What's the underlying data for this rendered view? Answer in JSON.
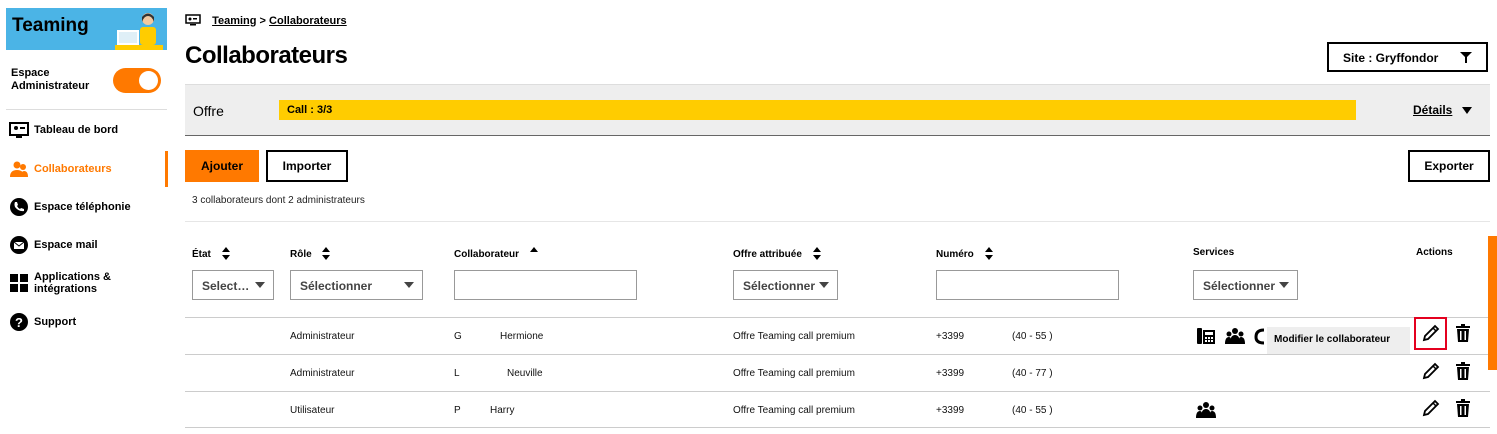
{
  "sidebar": {
    "brand": "Teaming",
    "admin_label": "Espace Administrateur",
    "admin_toggle_on": true,
    "items": [
      {
        "label": "Tableau de bord",
        "icon": "dashboard-icon"
      },
      {
        "label": "Collaborateurs",
        "icon": "users-icon",
        "active": true
      },
      {
        "label": "Espace téléphonie",
        "icon": "phone-icon"
      },
      {
        "label": "Espace mail",
        "icon": "mail-icon"
      },
      {
        "label": "Applications & intégrations",
        "icon": "apps-grid-icon"
      },
      {
        "label": "Support",
        "icon": "help-icon"
      }
    ]
  },
  "breadcrumb": {
    "home": "Teaming",
    "sep": ">",
    "current": "Collaborateurs"
  },
  "page_title": "Collaborateurs",
  "site_filter": "Site : Gryffondor",
  "offer": {
    "label": "Offre",
    "bar_text": "Call : 3/3",
    "details": "Détails"
  },
  "actions": {
    "add": "Ajouter",
    "import": "Importer",
    "export": "Exporter"
  },
  "summary": "3 collaborateurs dont 2 administrateurs",
  "columns": {
    "state": "État",
    "role": "Rôle",
    "collaborator": "Collaborateur",
    "offer": "Offre attribuée",
    "number": "Numéro",
    "services": "Services",
    "actions": "Actions"
  },
  "filters": {
    "state": "Select…",
    "role": "Sélectionner",
    "offer": "Sélectionner",
    "services": "Sélectionner"
  },
  "rows": [
    {
      "role": "Administrateur",
      "initial": "G",
      "name": "Hermione",
      "offer": "Offre Teaming call premium",
      "number": "+3399",
      "ext": "(40 - 55   )",
      "services": [
        "desk-phone-icon",
        "group-icon",
        "headset-icon"
      ]
    },
    {
      "role": "Administrateur",
      "initial": "L",
      "name": "Neuville",
      "offer": "Offre Teaming call premium",
      "number": "+3399",
      "ext": "(40 - 77   )",
      "services": []
    },
    {
      "role": "Utilisateur",
      "initial": "P",
      "name": "Harry",
      "offer": "Offre Teaming call premium",
      "number": "+3399",
      "ext": "(40 - 55   )",
      "services": [
        "group-icon"
      ]
    }
  ],
  "tooltip": "Modifier le collaborateur",
  "colors": {
    "accent": "#ff7900",
    "brand": "#4bb4e6",
    "progress": "#ffcc00",
    "highlight": "#e4001f"
  }
}
